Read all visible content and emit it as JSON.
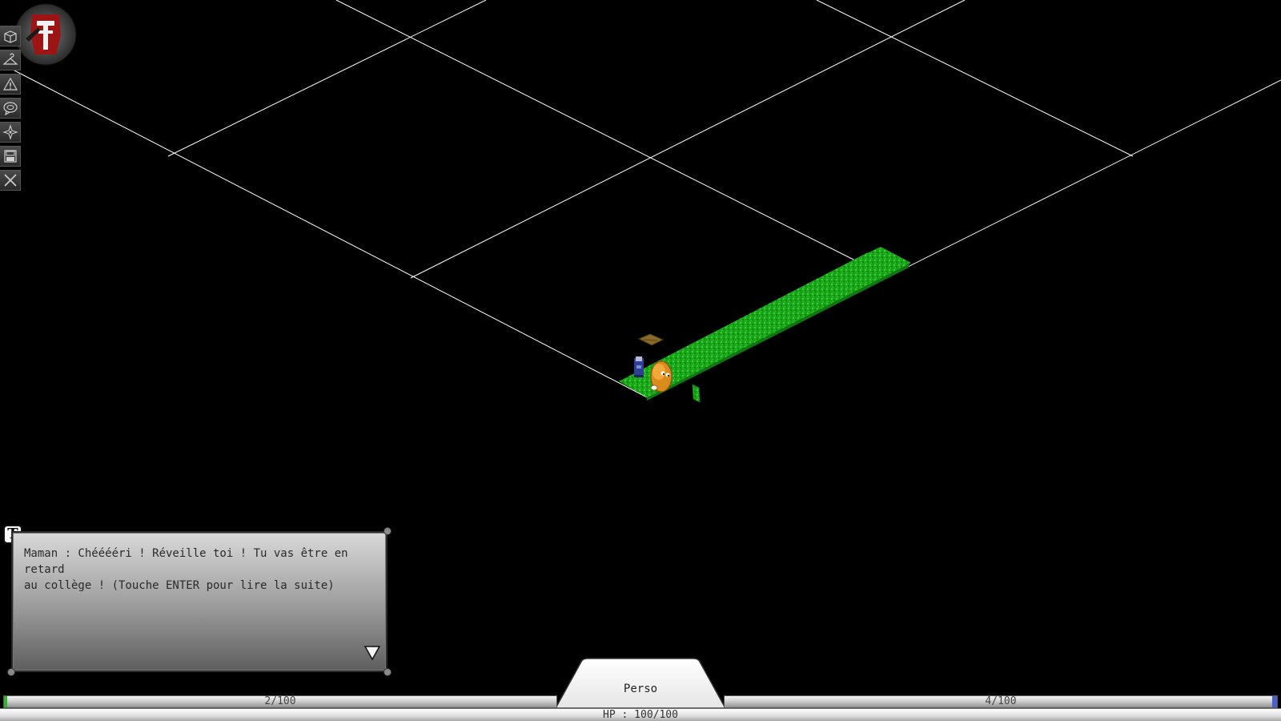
{
  "logo": {
    "icon": "game-logo-emblem"
  },
  "toolbar": {
    "tools": [
      {
        "name": "inventory-tool",
        "icon": "box-icon"
      },
      {
        "name": "equipment-tool",
        "icon": "hanger-icon"
      },
      {
        "name": "alerts-tool",
        "icon": "warning-icon"
      },
      {
        "name": "chat-tool",
        "icon": "speech-icon"
      },
      {
        "name": "map-tool",
        "icon": "compass-icon"
      },
      {
        "name": "save-tool",
        "icon": "floppy-icon"
      },
      {
        "name": "quit-tool",
        "icon": "close-icon"
      }
    ]
  },
  "dialog": {
    "badge": "T",
    "text": "Maman : Chééééri ! Réveille toi ! Tu vas être en retard\nau collège ! (Touche ENTER pour lire la suite)",
    "next_icon": "triangle-down-icon"
  },
  "stats": {
    "left_bar_label": "2/100",
    "left_bar_fraction": 0.02,
    "left_bar_color": "#2db52d",
    "right_bar_label": "4/100",
    "right_bar_fraction": 0.04,
    "right_bar_color": "#4a5fd0",
    "hp_label": "HP : 100/100"
  },
  "tab": {
    "label": "Perso"
  },
  "colors": {
    "background": "#000000",
    "grid": "#ffffff",
    "grass": "#1fae1f"
  }
}
